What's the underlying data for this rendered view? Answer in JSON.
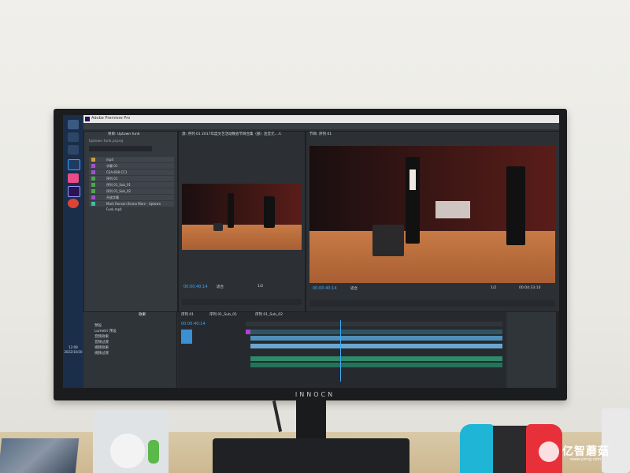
{
  "app": {
    "name": "Adobe Premiere Pro",
    "project_tab": "项目: Uptown funk",
    "project_file": "Uptown funk.prproj",
    "source_tab": "源: 序列 01 2017年度文艺活动晚会节目合集（部）连音元…人",
    "program_tab": "节目: 序列 01",
    "effects_tab": "效果",
    "timeline_tabs": [
      "序列 01",
      "序列 01_Sub_01",
      "序列 01_Sub_02"
    ],
    "timecode_source": "00:00:40:14",
    "timecode_program": "00:00:40:14",
    "timecode_duration": "00:04:33:10",
    "timeline_timecode": "00:00:40:14",
    "fit_label": "适合",
    "zoom_label": "1/2"
  },
  "project_items": [
    {
      "label": "mp4",
      "color": "#c9a23a"
    },
    {
      "label": "字幕 01",
      "color": "#a24fd1"
    },
    {
      "label": "CEA-608 CC1",
      "color": "#a24fd1"
    },
    {
      "label": "序列 01",
      "color": "#4aa84a"
    },
    {
      "label": "序列 01_Sub_01",
      "color": "#4aa84a"
    },
    {
      "label": "序列 01_Sub_02",
      "color": "#4aa84a"
    },
    {
      "label": "开放字幕",
      "color": "#a24fd1"
    },
    {
      "label": "Mark Ronson Bruno Mars - Uptown Funk.mp4",
      "color": "#3fbf9f"
    }
  ],
  "effects_items": [
    "预设",
    "Lumetri 预设",
    "音频效果",
    "音频过渡",
    "视频效果",
    "视频过渡"
  ],
  "taskbar": {
    "time": "12:08",
    "date": "2022/10/30"
  },
  "monitor_brand": "INNOCN",
  "watermark": {
    "text": "亿智蘑菇",
    "url": "www.yzmg.com"
  }
}
